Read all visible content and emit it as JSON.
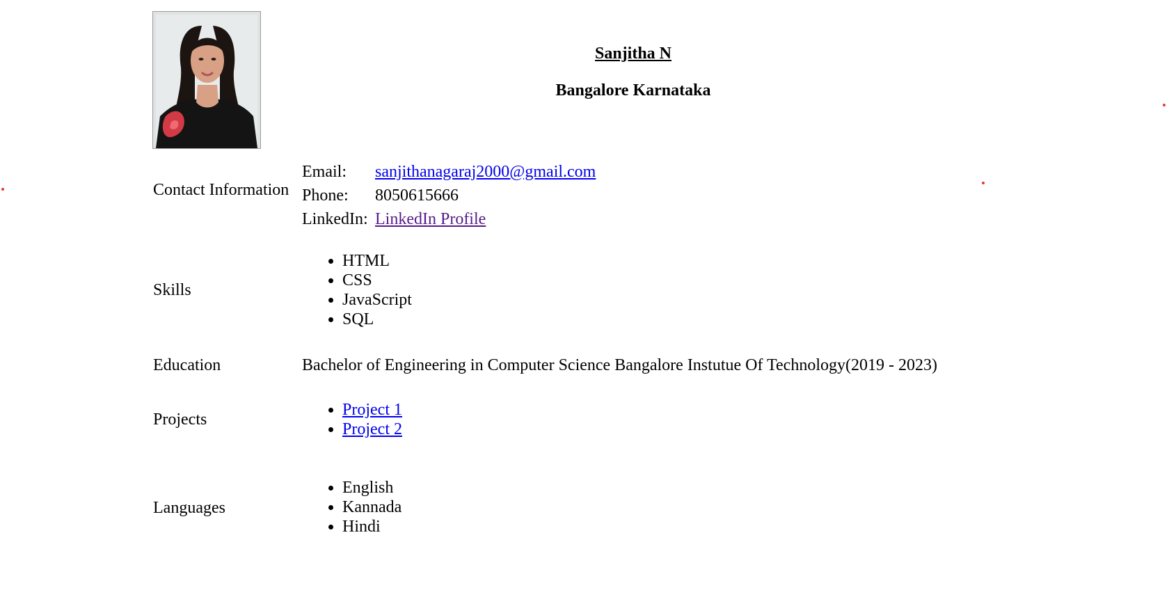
{
  "header": {
    "name": "Sanjitha N",
    "location": "Bangalore Karnataka"
  },
  "photo": {
    "icon": "profile-photo",
    "colors": {
      "background": "#dfe3e4",
      "hair": "#1b1410",
      "skin": "#d8a085",
      "dress": "#141414",
      "flower": "#d23b45"
    }
  },
  "contact": {
    "label": "Contact Information",
    "email_label": "Email:",
    "email_value": "sanjithanagaraj2000@gmail.com",
    "phone_label": "Phone:",
    "phone_value": "8050615666",
    "linkedin_label": "LinkedIn:",
    "linkedin_value": "LinkedIn Profile"
  },
  "skills": {
    "label": "Skills",
    "items": [
      "HTML",
      "CSS",
      "JavaScript",
      "SQL"
    ]
  },
  "education": {
    "label": "Education",
    "value": "Bachelor of Engineering in Computer Science Bangalore Instutue Of Technology(2019 - 2023)"
  },
  "projects": {
    "label": "Projects",
    "items": [
      "Project 1",
      "Project 2"
    ]
  },
  "languages": {
    "label": "Languages",
    "items": [
      "English",
      "Kannada",
      "Hindi"
    ]
  },
  "colors": {
    "link": "#0000ee",
    "visited_link": "#551a8b",
    "marker_dots": "#e53935"
  }
}
